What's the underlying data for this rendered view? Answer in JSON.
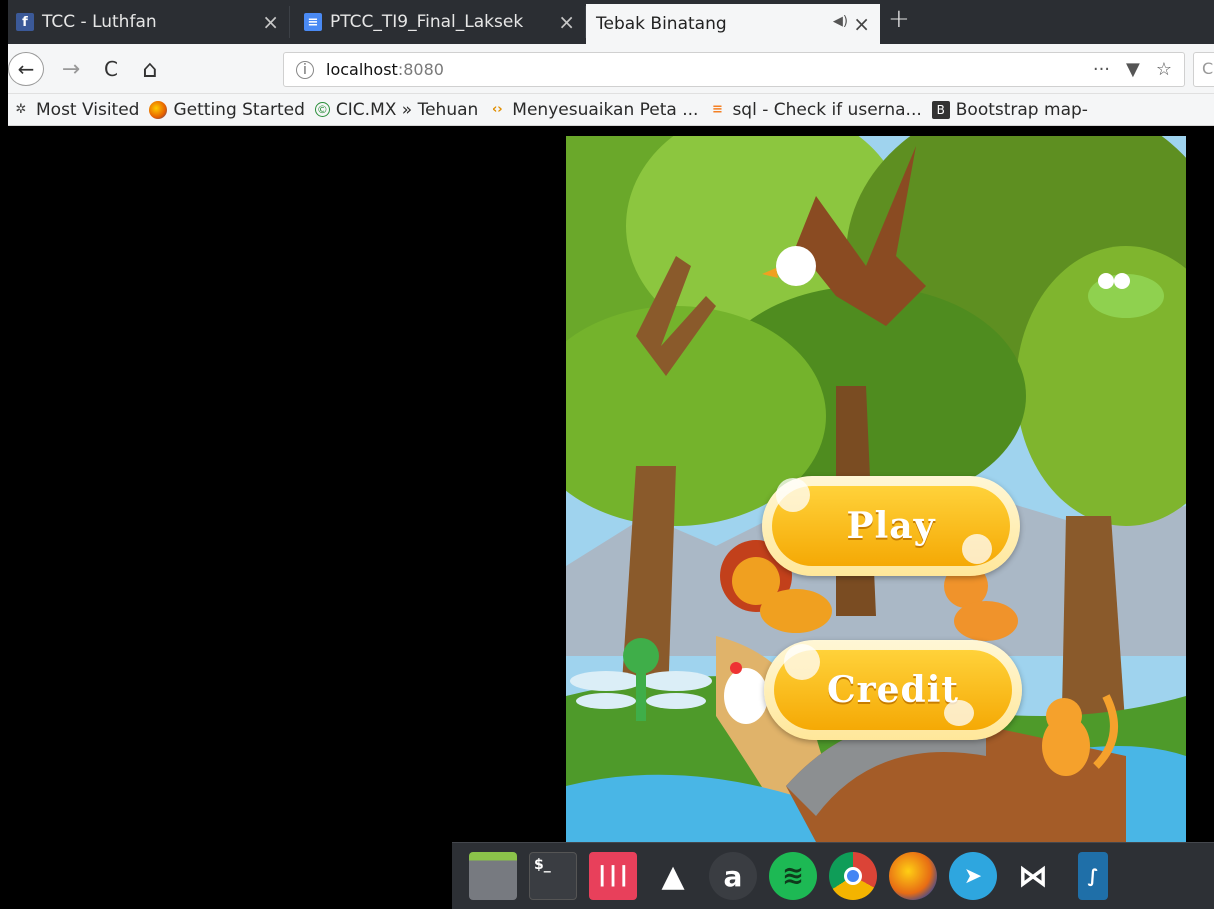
{
  "tabs": [
    {
      "title": "TCC - Luthfan",
      "favicon": "facebook-icon",
      "active": false
    },
    {
      "title": "PTCC_TI9_Final_Laksek",
      "favicon": "docs-icon",
      "active": false
    },
    {
      "title": "Tebak Binatang",
      "favicon": "",
      "active": true,
      "audio": "speaker-icon"
    }
  ],
  "new_tab_label": "+",
  "tab_close_glyph": "×",
  "url": {
    "host": "localhost",
    "port": ":8080"
  },
  "bookmarks": [
    {
      "label": "Most Visited",
      "icon": "gear-icon"
    },
    {
      "label": "Getting Started",
      "icon": "firefox-icon"
    },
    {
      "label": "CIC.MX » Tehuan",
      "icon": "cic-icon"
    },
    {
      "label": "Menyesuaikan Peta ...",
      "icon": "code-icon"
    },
    {
      "label": "sql - Check if userna...",
      "icon": "stackoverflow-icon"
    },
    {
      "label": "Bootstrap map-",
      "icon": "bootstrap-icon"
    }
  ],
  "game": {
    "title": "Tebak Binatang",
    "play_label": "Play",
    "credit_label": "Credit"
  },
  "dock": [
    {
      "name": "files-app-icon",
      "color": "#6b6e73"
    },
    {
      "name": "terminal-app-icon",
      "color": "#3a3d42"
    },
    {
      "name": "mixer-app-icon",
      "color": "#e8405b"
    },
    {
      "name": "inkscape-app-icon",
      "color": "#3a3d42"
    },
    {
      "name": "amazon-app-icon",
      "color": "#3a3d42"
    },
    {
      "name": "spotify-app-icon",
      "color": "#1db954"
    },
    {
      "name": "chrome-app-icon",
      "color": "#3a3d42"
    },
    {
      "name": "firefox-app-icon",
      "color": "#e66000"
    },
    {
      "name": "telegram-app-icon",
      "color": "#2ea6df"
    },
    {
      "name": "vscode-app-icon",
      "color": "#7b54c9"
    },
    {
      "name": "mysql-workbench-app-icon",
      "color": "#1f6fa8"
    }
  ],
  "dock_labels": {
    "amazon": "a",
    "terminal": "$_"
  },
  "toolbar_glyphs": {
    "back": "←",
    "forward": "→",
    "reload": "C",
    "home": "⌂",
    "info": "i",
    "more": "···",
    "pocket": "▼",
    "star": "☆",
    "search": "C"
  },
  "audio_glyph": "◀)",
  "bookmark_glyphs": {
    "most_visited": "✲",
    "code": "‹›",
    "stack": "≡",
    "bootstrap": "B",
    "cic": "©"
  }
}
